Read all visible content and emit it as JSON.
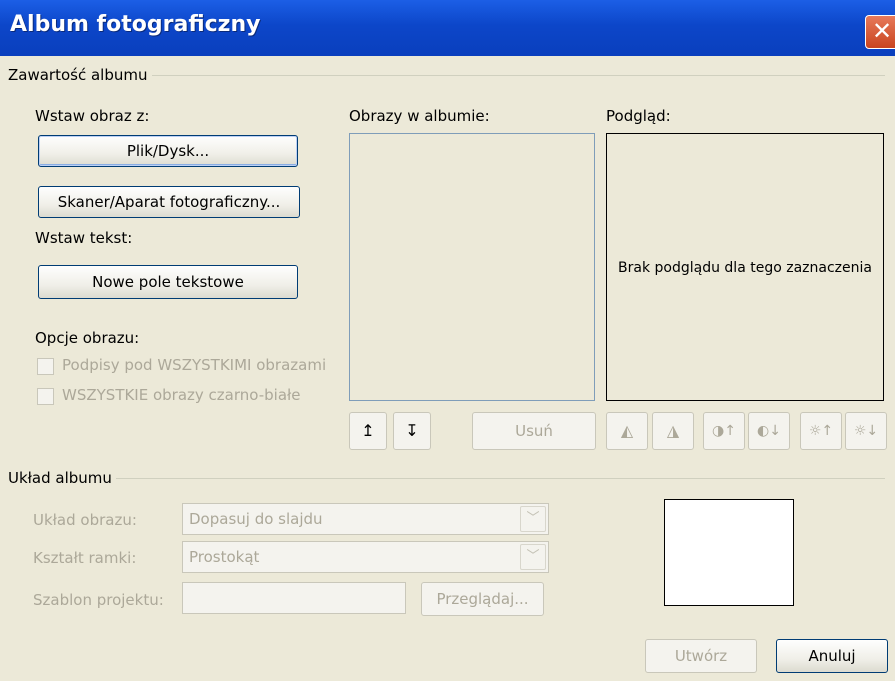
{
  "window": {
    "title": "Album fotograficzny",
    "close_glyph": "✕"
  },
  "content_group": {
    "label": "Zawartość albumu"
  },
  "insert_image": {
    "label": "Wstaw obraz z:",
    "file_button": "Plik/Dysk...",
    "scanner_button": "Skaner/Aparat fotograficzny..."
  },
  "insert_text": {
    "label": "Wstaw tekst:",
    "new_textbox_button": "Nowe pole tekstowe"
  },
  "image_options": {
    "label": "Opcje obrazu:",
    "captions_checkbox": "Podpisy pod WSZYSTKIMI obrazami",
    "bw_checkbox": "WSZYSTKIE obrazy czarno-białe"
  },
  "pictures_list": {
    "label": "Obrazy w albumie:"
  },
  "preview": {
    "label": "Podgląd:",
    "empty_text": "Brak podglądu dla tego zaznaczenia"
  },
  "list_controls": {
    "move_up_glyph": "↥",
    "move_down_glyph": "↧",
    "remove_button": "Usuń"
  },
  "image_tools": {
    "rotate_left_glyph": "◭",
    "rotate_right_glyph": "◮",
    "contrast_up_glyph": "◑↑",
    "contrast_down_glyph": "◐↓",
    "brightness_up_glyph": "☼↑",
    "brightness_down_glyph": "☼↓"
  },
  "layout_group": {
    "label": "Układ albumu",
    "picture_layout_label": "Układ obrazu:",
    "picture_layout_value": "Dopasuj do slajdu",
    "frame_shape_label": "Kształt ramki:",
    "frame_shape_value": "Prostokąt",
    "design_template_label": "Szablon projektu:",
    "design_template_value": "",
    "browse_button": "Przeglądaj...",
    "dropdown_glyph": "﹀"
  },
  "footer": {
    "create_button": "Utwórz",
    "cancel_button": "Anuluj"
  }
}
